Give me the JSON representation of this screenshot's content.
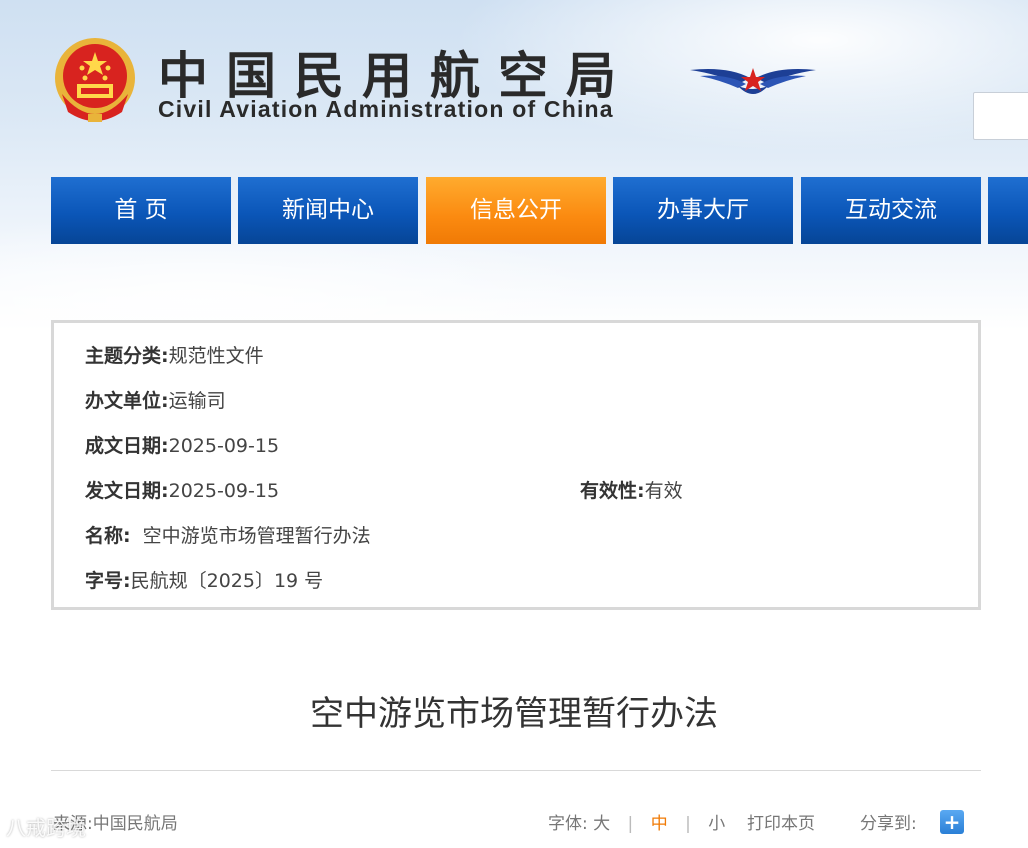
{
  "header": {
    "title_cn": "中国民用航空局",
    "title_en": "Civil Aviation Administration of China",
    "emblem_icon": "national-emblem-icon",
    "logo_icon": "caac-wing-logo-icon"
  },
  "nav": {
    "items": [
      {
        "label": "首 页"
      },
      {
        "label": "新闻中心"
      },
      {
        "label": "信息公开"
      },
      {
        "label": "办事大厅"
      },
      {
        "label": "互动交流"
      }
    ],
    "active_index": 2
  },
  "info": {
    "topic_label": "主题分类:",
    "topic_value": "规范性文件",
    "unit_label": "办文单位:",
    "unit_value": "运输司",
    "created_label": "成文日期:",
    "created_value": "2025-09-15",
    "issued_label": "发文日期:",
    "issued_value": "2025-09-15",
    "validity_label": "有效性:",
    "validity_value": "有效",
    "name_label": "名称:",
    "name_value": "空中游览市场管理暂行办法",
    "doc_no_label": "字号:",
    "doc_no_value": "民航规〔2025〕19 号"
  },
  "article": {
    "title": "空中游览市场管理暂行办法"
  },
  "meta": {
    "source": "来源:中国民航局",
    "font_label": "字体:",
    "font_large": "大",
    "font_medium": "中",
    "font_small": "小",
    "sep": "|",
    "print": "打印本页",
    "share_label": "分享到:",
    "share_icon": "+"
  },
  "watermark": "八戒跨境",
  "colors": {
    "nav_blue": "#0b56b8",
    "nav_active": "#fb8a10"
  }
}
